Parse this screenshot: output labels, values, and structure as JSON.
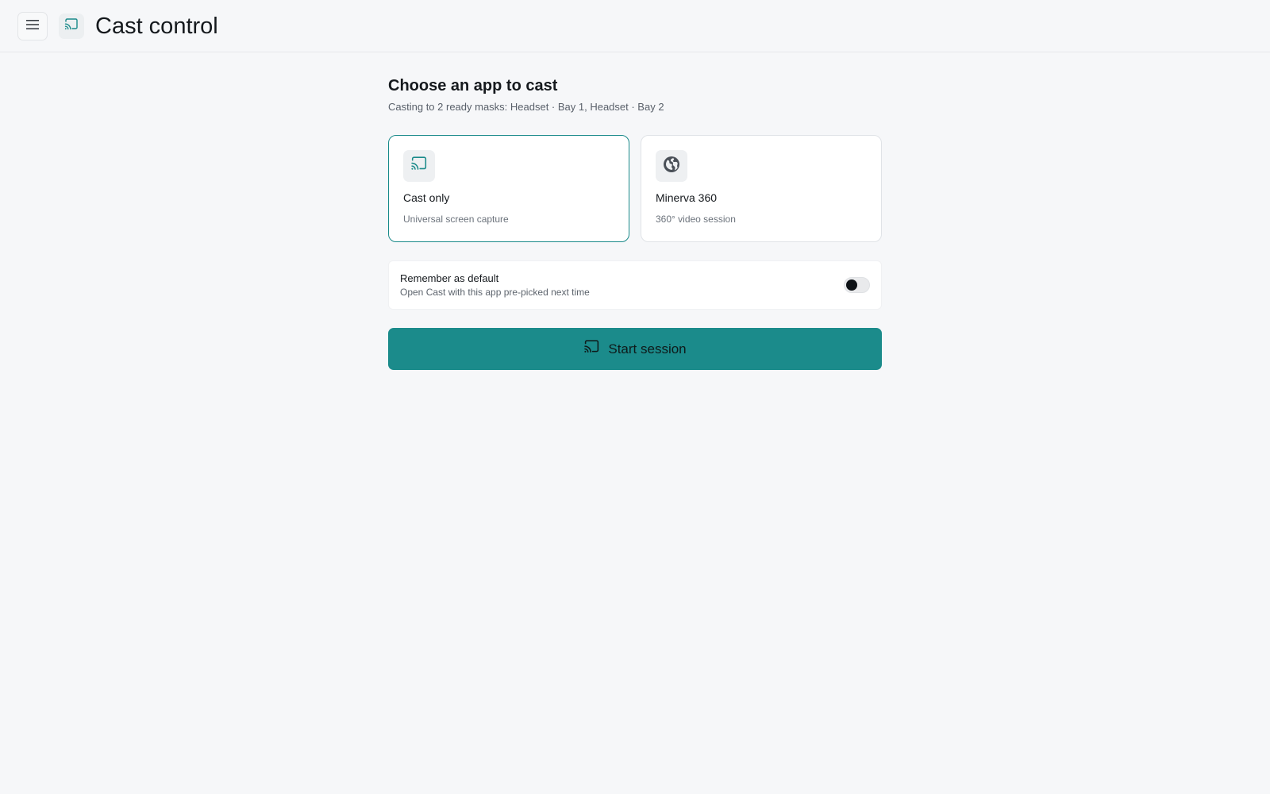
{
  "header": {
    "title": "Cast control",
    "menu_icon": "hamburger-menu-icon",
    "app_icon": "cast-icon"
  },
  "main": {
    "heading": "Choose an app to cast",
    "subheading": "Casting to 2 ready masks: Headset · Bay 1, Headset · Bay 2",
    "apps": [
      {
        "name": "Cast only",
        "description": "Universal screen capture",
        "icon": "cast-icon",
        "selected": true
      },
      {
        "name": "Minerva 360",
        "description": "360° video session",
        "icon": "globe-icon",
        "selected": false
      }
    ],
    "default_toggle": {
      "title": "Remember as default",
      "description": "Open Cast with this app pre-picked next time",
      "enabled": false
    },
    "start_button": {
      "label": "Start session",
      "icon": "cast-icon"
    }
  },
  "colors": {
    "accent": "#1b8b8b",
    "background": "#f6f7f9",
    "card_background": "#ffffff"
  }
}
